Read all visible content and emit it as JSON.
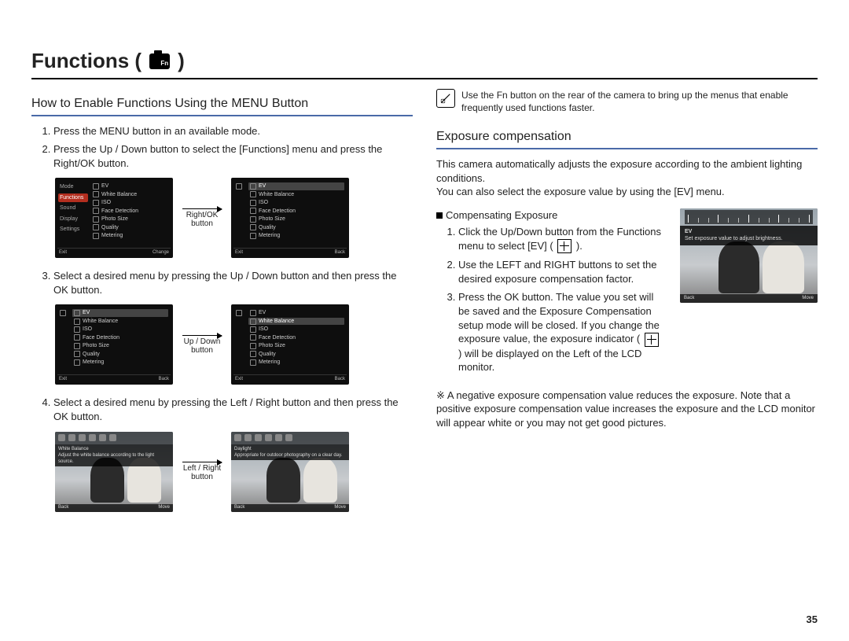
{
  "page": {
    "title": "Functions (",
    "title_suffix": " )",
    "number": "35"
  },
  "left": {
    "heading": "How to Enable Functions Using the MENU Button",
    "steps": {
      "s1": "Press the MENU button in an available mode.",
      "s2": "Press the Up / Down button to select the [Functions] menu and press the Right/OK button.",
      "s3": "Select a desired menu by pressing the Up / Down button and then press the OK button.",
      "s4": "Select a desired menu by pressing the Left / Right button and then press the OK button."
    },
    "arrows": {
      "a1l1": "Right/OK",
      "a1l2": "button",
      "a2l1": "Up / Down",
      "a2l2": "button",
      "a3l1": "Left / Right",
      "a3l2": "button"
    },
    "scr1": {
      "left": [
        "Mode",
        "Functions",
        "Sound",
        "Display",
        "Settings"
      ],
      "right": [
        "EV",
        "White Balance",
        "ISO",
        "Face Detection",
        "Photo Size",
        "Quality",
        "Metering"
      ],
      "footL": "Exit",
      "footR": "Change"
    },
    "scr2": {
      "right": [
        "EV",
        "White Balance",
        "ISO",
        "Face Detection",
        "Photo Size",
        "Quality",
        "Metering"
      ],
      "footL": "Exit",
      "footR": "Back"
    },
    "scr3": {
      "right": [
        "EV",
        "White Balance",
        "ISO",
        "Face Detection",
        "Photo Size",
        "Quality",
        "Metering"
      ],
      "footL": "Exit",
      "footR": "Back"
    },
    "scr4": {
      "right": [
        "EV",
        "White Balance",
        "ISO",
        "Face Detection",
        "Photo Size",
        "Quality",
        "Metering"
      ],
      "footL": "Exit",
      "footR": "Back"
    },
    "scr5": {
      "title": "White Balance",
      "caption": "Adjust the white balance according to the light source.",
      "footL": "Back",
      "footR": "Move"
    },
    "scr6": {
      "title": "Daylight",
      "caption": "Appropriate for outdoor photography on a clear day.",
      "footL": "Back",
      "footR": "Move"
    }
  },
  "right": {
    "tip": "Use the Fn button on the rear of the camera to bring up the menus that enable frequently used functions faster.",
    "heading": "Exposure compensation",
    "intro1": "This camera automatically adjusts the exposure according to the ambient lighting conditions.",
    "intro2": "You can also select the exposure value by using the [EV] menu.",
    "subhead": "Compensating Exposure",
    "steps": {
      "s1a": "Click the Up/Down button from the Functions menu to select [EV] (",
      "s1b": ").",
      "s2": "Use the LEFT and RIGHT buttons to set the desired exposure compensation factor.",
      "s3a": "Press the OK button. The value you set will be saved and the Exposure Compensation setup mode will be closed. If you change the exposure value, the exposure indicator (",
      "s3b": ") will be displayed on the Left of the LCD monitor."
    },
    "note_marker": "※",
    "note": "A negative exposure compensation value reduces the exposure. Note that a positive exposure compensation value increases the exposure and the LCD monitor will appear white or you may not get good pictures.",
    "evscr": {
      "label": "EV",
      "caption": "Set exposure value to adjust brightness.",
      "footL": "Back",
      "footR": "Move"
    }
  }
}
